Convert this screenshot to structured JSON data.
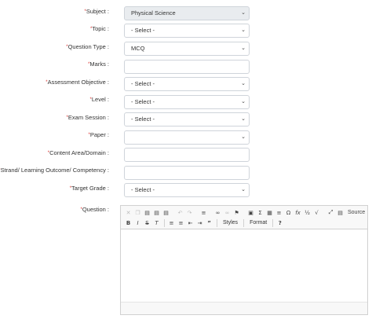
{
  "form": {
    "subject": {
      "label": "Subject :",
      "value": "Physical Science"
    },
    "topic": {
      "label": "Topic :",
      "value": "- Select -"
    },
    "question_type": {
      "label": "Question Type :",
      "value": "MCQ"
    },
    "marks": {
      "label": "Marks :",
      "value": ""
    },
    "assessment_objective": {
      "label": "Assessment Objective :",
      "value": "- Select -"
    },
    "level": {
      "label": "Level :",
      "value": "- Select -"
    },
    "exam_session": {
      "label": "Exam Session :",
      "value": "- Select -"
    },
    "paper": {
      "label": "Paper :",
      "value": ""
    },
    "content_area": {
      "label": "Content Area/Domain :",
      "value": ""
    },
    "strand": {
      "label": "Strand/ Learning Outcome/ Competency :",
      "value": ""
    },
    "target_grade": {
      "label": "Target Grade :",
      "value": "- Select -"
    },
    "question": {
      "label": "Question :"
    }
  },
  "required_mark": "*",
  "editor": {
    "source_label": "Source",
    "styles_label": "Styles",
    "format_label": "Format",
    "help_label": "?"
  }
}
